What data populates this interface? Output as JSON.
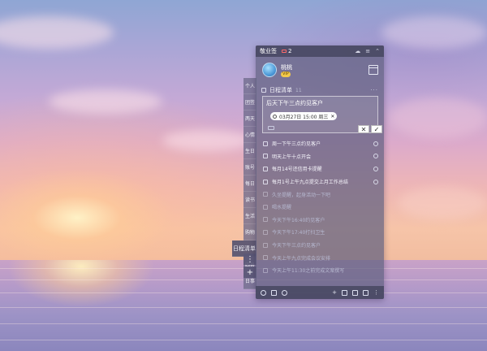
{
  "app": {
    "title": "敬业签",
    "mail_count": "2",
    "icons": [
      "cloud-icon",
      "menu-icon",
      "collapse-icon"
    ]
  },
  "user": {
    "name": "桃桃",
    "badge": "VIP",
    "calendar_icon": "calendar-icon"
  },
  "tabs": {
    "items": [
      "个人",
      "团签",
      "两天",
      "心情",
      "生日",
      "账号",
      "每日",
      "读书",
      "生活",
      "购物"
    ],
    "active": "日程清单",
    "after": [
      "四县",
      "日事"
    ],
    "more": "⋮",
    "add": "+"
  },
  "section": {
    "title": "日程清单",
    "count": "11",
    "more": "···"
  },
  "editor": {
    "text": "后天下午三点约见客户",
    "date_chip": "03月27日 15:00 周三",
    "cancel": "✕",
    "confirm": "✓"
  },
  "list": {
    "pending": [
      "周一下午三点约见客户",
      "明天上午十点开会",
      "每月14号还信用卡提醒",
      "每月1号上午九点提交上月工作总结"
    ],
    "completed": [
      "久坐提醒，起身活动一下吧",
      "喝水提醒",
      "今天下午16:40约见客户",
      "今天下午17:40打扫卫生",
      "今天下午三点约见客户",
      "今天上午九点完成会议安排",
      "今天上午11:30之前完成文案撰写"
    ]
  },
  "colors": {
    "panel_bg": "#606080",
    "titlebar_bg": "#464660",
    "mail_accent": "#ff6a6a",
    "vip_gold": "#f3c94a"
  }
}
